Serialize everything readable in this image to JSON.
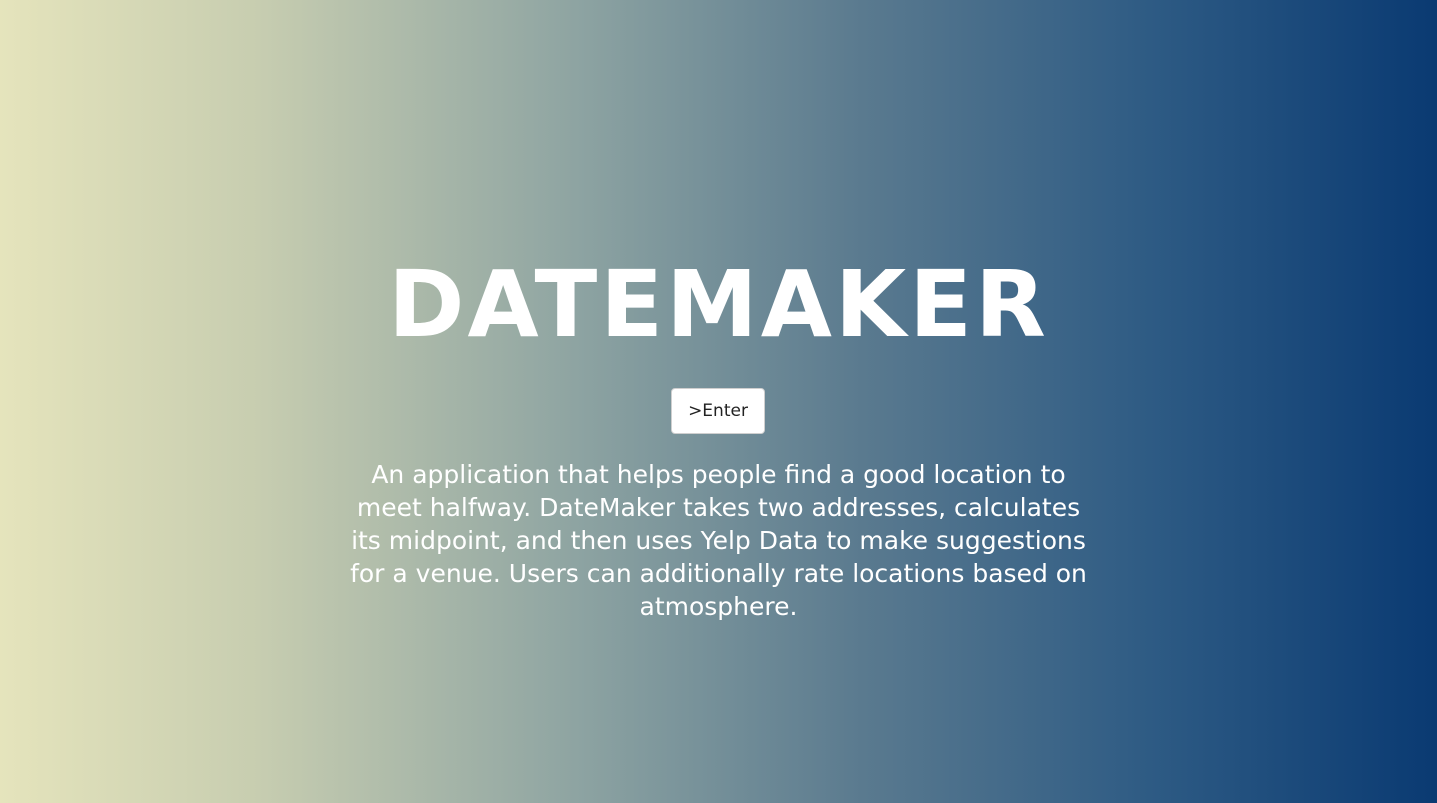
{
  "hero": {
    "title": "DATEMAKER",
    "enter_button_label": ">Enter",
    "description": "An application that helps people find a good location to meet halfway. DateMaker takes two addresses, calculates its midpoint, and then uses Yelp Data to make suggestions for a venue. Users can additionally rate locations based on atmosphere."
  },
  "colors": {
    "gradient_left": "#e5e4bc",
    "gradient_right": "#0a3a72",
    "text": "#ffffff",
    "button_background": "#ffffff"
  }
}
